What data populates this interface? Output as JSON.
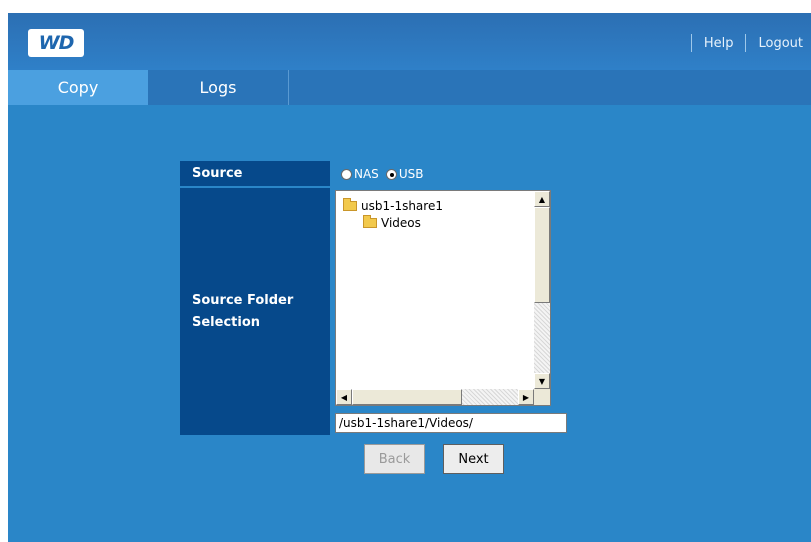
{
  "header": {
    "logo_text": "WD",
    "help_label": "Help",
    "logout_label": "Logout"
  },
  "tabs": [
    {
      "label": "Copy",
      "active": true
    },
    {
      "label": "Logs",
      "active": false
    }
  ],
  "form": {
    "source_label": "Source",
    "source_options": [
      {
        "label": "NAS",
        "selected": false
      },
      {
        "label": "USB",
        "selected": true
      }
    ],
    "folder_label_line1": "Source Folder",
    "folder_label_line2": "Selection",
    "tree": [
      {
        "label": "usb1-1share1",
        "level": 0,
        "icon": "folder-open-icon"
      },
      {
        "label": "Videos",
        "level": 1,
        "icon": "folder-icon"
      }
    ],
    "path_value": "/usb1-1share1/Videos/"
  },
  "buttons": {
    "back_label": "Back",
    "back_enabled": false,
    "next_label": "Next"
  },
  "colors": {
    "page_bg": "#2a86c8",
    "label_bg": "#06498b",
    "active_tab": "#4ba0e0"
  }
}
